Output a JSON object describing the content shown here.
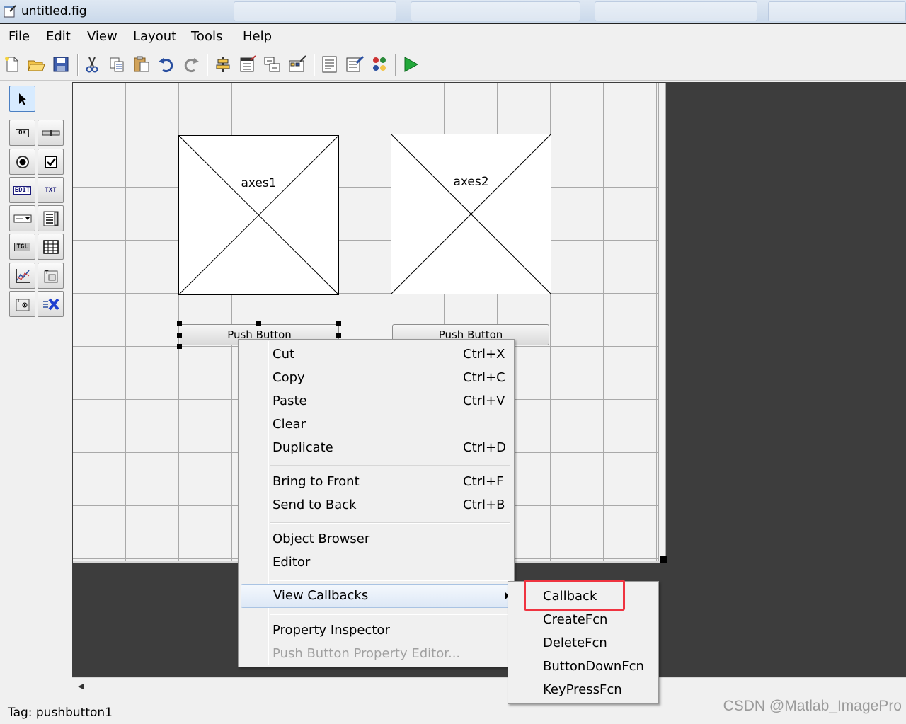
{
  "window": {
    "title": "untitled.fig"
  },
  "menubar": {
    "items": [
      "File",
      "Edit",
      "View",
      "Layout",
      "Tools",
      "Help"
    ]
  },
  "toolbar": {
    "icons": [
      "new-icon",
      "open-icon",
      "save-icon",
      "cut-icon",
      "copy-icon",
      "paste-icon",
      "undo-icon",
      "redo-icon",
      "align-icon",
      "menu-editor-icon",
      "tab-order-icon",
      "toolbar-editor-icon",
      "mfile-editor-icon",
      "property-inspector-icon",
      "object-browser-icon",
      "run-icon"
    ]
  },
  "palette": {
    "items": [
      {
        "name": "select-tool",
        "label": ""
      },
      {
        "name": "pushbutton-tool",
        "label": "OK"
      },
      {
        "name": "slider-tool",
        "label": ""
      },
      {
        "name": "radiobutton-tool",
        "label": ""
      },
      {
        "name": "checkbox-tool",
        "label": ""
      },
      {
        "name": "edit-text-tool",
        "label": "EDIT"
      },
      {
        "name": "static-text-tool",
        "label": "TXT"
      },
      {
        "name": "popup-menu-tool",
        "label": ""
      },
      {
        "name": "listbox-tool",
        "label": ""
      },
      {
        "name": "toggle-button-tool",
        "label": "TGL"
      },
      {
        "name": "table-tool",
        "label": ""
      },
      {
        "name": "axes-tool",
        "label": ""
      },
      {
        "name": "panel-tool",
        "label": ""
      },
      {
        "name": "button-group-tool",
        "label": ""
      },
      {
        "name": "activex-tool",
        "label": ""
      }
    ]
  },
  "canvas": {
    "axes1": {
      "label": "axes1"
    },
    "axes2": {
      "label": "axes2"
    },
    "button1": {
      "label": "Push Button"
    },
    "button2": {
      "label": "Push Button"
    }
  },
  "context_menu": {
    "items": [
      {
        "label": "Cut",
        "shortcut": "Ctrl+X"
      },
      {
        "label": "Copy",
        "shortcut": "Ctrl+C"
      },
      {
        "label": "Paste",
        "shortcut": "Ctrl+V"
      },
      {
        "label": "Clear",
        "shortcut": ""
      },
      {
        "label": "Duplicate",
        "shortcut": "Ctrl+D"
      },
      {
        "label": "Bring to Front",
        "shortcut": "Ctrl+F"
      },
      {
        "label": "Send to Back",
        "shortcut": "Ctrl+B"
      },
      {
        "label": "Object Browser",
        "shortcut": ""
      },
      {
        "label": "Editor",
        "shortcut": ""
      },
      {
        "label": "View Callbacks",
        "shortcut": ""
      },
      {
        "label": "Property Inspector",
        "shortcut": ""
      },
      {
        "label": "Push Button Property Editor...",
        "shortcut": ""
      }
    ],
    "highlighted": "View Callbacks",
    "disabled": "Push Button Property Editor..."
  },
  "submenu": {
    "items": [
      "Callback",
      "CreateFcn",
      "DeleteFcn",
      "ButtonDownFcn",
      "KeyPressFcn"
    ],
    "annotated": "Callback",
    "annotation_color": "#ef3340"
  },
  "statusbar": {
    "text": "Tag: pushbutton1"
  },
  "watermark": {
    "text": "CSDN @Matlab_ImagePro"
  }
}
